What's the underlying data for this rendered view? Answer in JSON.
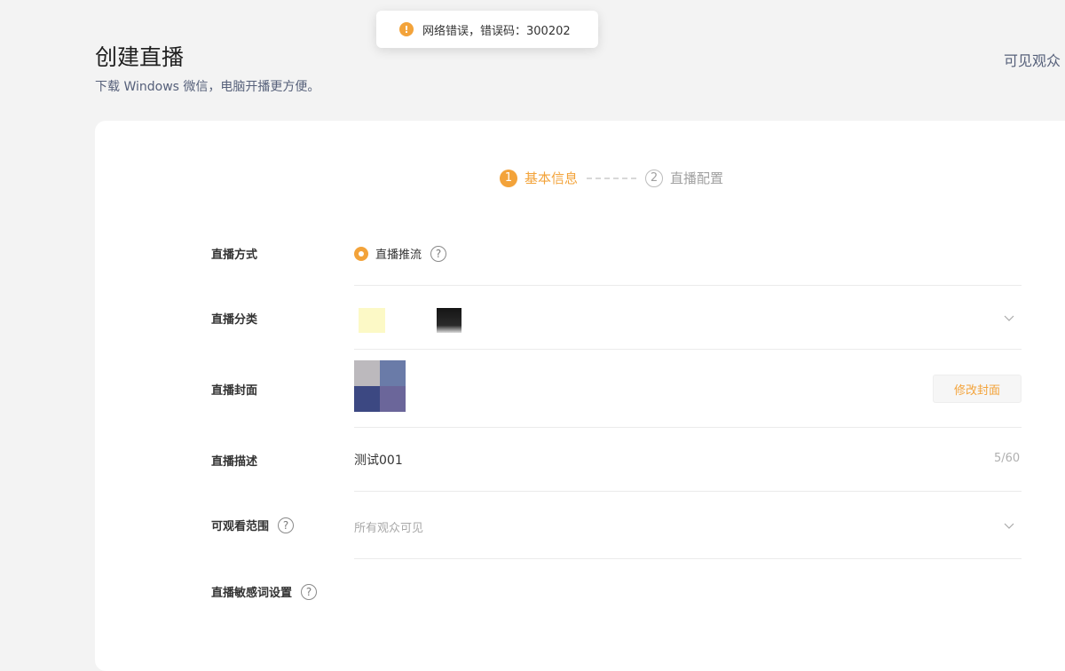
{
  "toast": {
    "icon": "!",
    "message": "网络错误，错误码：300202"
  },
  "header": {
    "title": "创建直播",
    "subtitle": "下载 Windows 微信，电脑开播更方便。",
    "right_link": "可见观众"
  },
  "steps": [
    {
      "number": "1",
      "label": "基本信息",
      "state": "active"
    },
    {
      "number": "2",
      "label": "直播配置",
      "state": "inactive"
    }
  ],
  "form": {
    "live_mode": {
      "label": "直播方式",
      "option": "直播推流",
      "help": "?"
    },
    "category": {
      "label": "直播分类"
    },
    "cover": {
      "label": "直播封面",
      "button": "修改封面"
    },
    "description": {
      "label": "直播描述",
      "value": "测试001",
      "counter": "5/60"
    },
    "visibility": {
      "label": "可观看范围",
      "help": "?",
      "placeholder": "所有观众可见"
    },
    "sensitive_words": {
      "label": "直播敏感词设置",
      "help": "?"
    }
  },
  "colors": {
    "accent": "#f3a33a",
    "background": "#f3f3f3",
    "card": "#ffffff"
  },
  "icons": [
    "warning-icon",
    "help-icon",
    "chevron-down-icon",
    "radio-checked-icon"
  ]
}
